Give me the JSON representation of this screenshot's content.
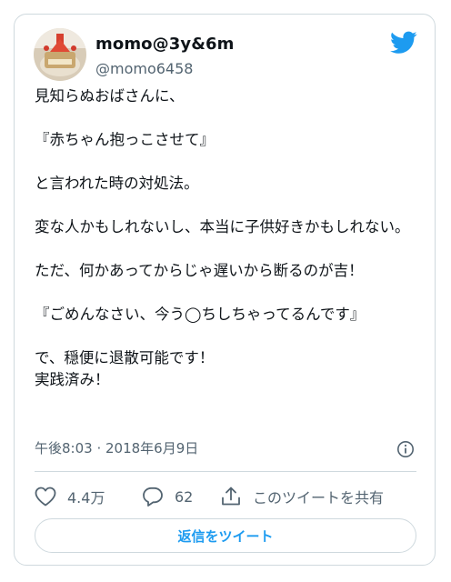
{
  "author": {
    "display_name": "momo@3y&6m",
    "handle": "@momo6458"
  },
  "tweet": {
    "text": "見知らぬおばさんに、\n\n『赤ちゃん抱っこさせて』\n\nと言われた時の対処法。\n\n変な人かもしれないし、本当に子供好きかもしれない。\n\nただ、何かあってからじゃ遅いから断るのが吉！\n\n『ごめんなさい、今う◯ちしちゃってるんです』\n\nで、穏便に退散可能です！\n実践済み！",
    "timestamp": "午後8:03 · 2018年6月9日"
  },
  "actions": {
    "like_count": "4.4万",
    "reply_count": "62",
    "share_label": "このツイートを共有"
  },
  "reply_button_label": "返信をツイート",
  "colors": {
    "brand": "#1d9bf0",
    "secondary_text": "#536471",
    "border": "#cfd9de"
  },
  "icons": [
    "twitter-bird-icon",
    "info-icon",
    "heart-icon",
    "reply-bubble-icon",
    "share-icon"
  ]
}
